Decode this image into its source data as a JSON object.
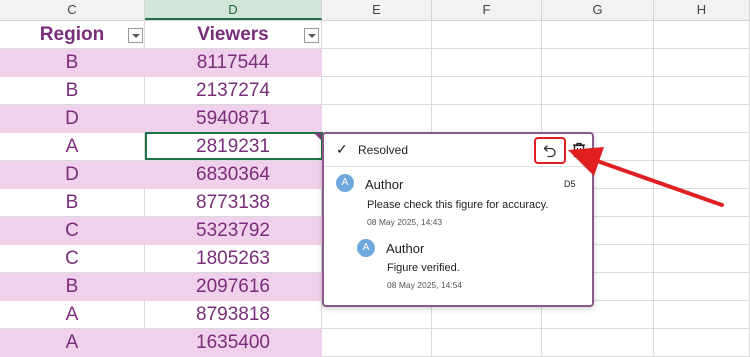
{
  "columns": [
    {
      "label": "C",
      "selected": false
    },
    {
      "label": "D",
      "selected": true
    },
    {
      "label": "E",
      "selected": false
    },
    {
      "label": "F",
      "selected": false
    },
    {
      "label": "G",
      "selected": false
    },
    {
      "label": "H",
      "selected": false
    }
  ],
  "table": {
    "headers": {
      "region": "Region",
      "viewers": "Viewers"
    },
    "rows": [
      {
        "region": "B",
        "viewers": "8117544"
      },
      {
        "region": "B",
        "viewers": "2137274"
      },
      {
        "region": "D",
        "viewers": "5940871"
      },
      {
        "region": "A",
        "viewers": "2819231"
      },
      {
        "region": "D",
        "viewers": "6830364"
      },
      {
        "region": "B",
        "viewers": "8773138"
      },
      {
        "region": "C",
        "viewers": "5323792"
      },
      {
        "region": "C",
        "viewers": "1805263"
      },
      {
        "region": "B",
        "viewers": "2097616"
      },
      {
        "region": "A",
        "viewers": "8793818"
      },
      {
        "region": "A",
        "viewers": "1635400"
      }
    ]
  },
  "comment_thread": {
    "status_label": "Resolved",
    "cell_ref": "D5",
    "comments": [
      {
        "avatar": "A",
        "author": "Author",
        "text": "Please check this figure for accuracy.",
        "date": "08 May 2025, 14:43"
      },
      {
        "avatar": "A",
        "author": "Author",
        "text": "Figure verified.",
        "date": "08 May 2025, 14:54"
      }
    ]
  },
  "colors": {
    "band": "#f0d0ea",
    "text": "#7a2d7a",
    "accent_green": "#1e7145",
    "highlight_red": "#e02020",
    "panel_border": "#8b5a8b"
  },
  "icons": {
    "resolved": "check-icon",
    "reopen": "reopen-icon",
    "delete": "trash-icon",
    "filter": "filter-dropdown-icon"
  }
}
